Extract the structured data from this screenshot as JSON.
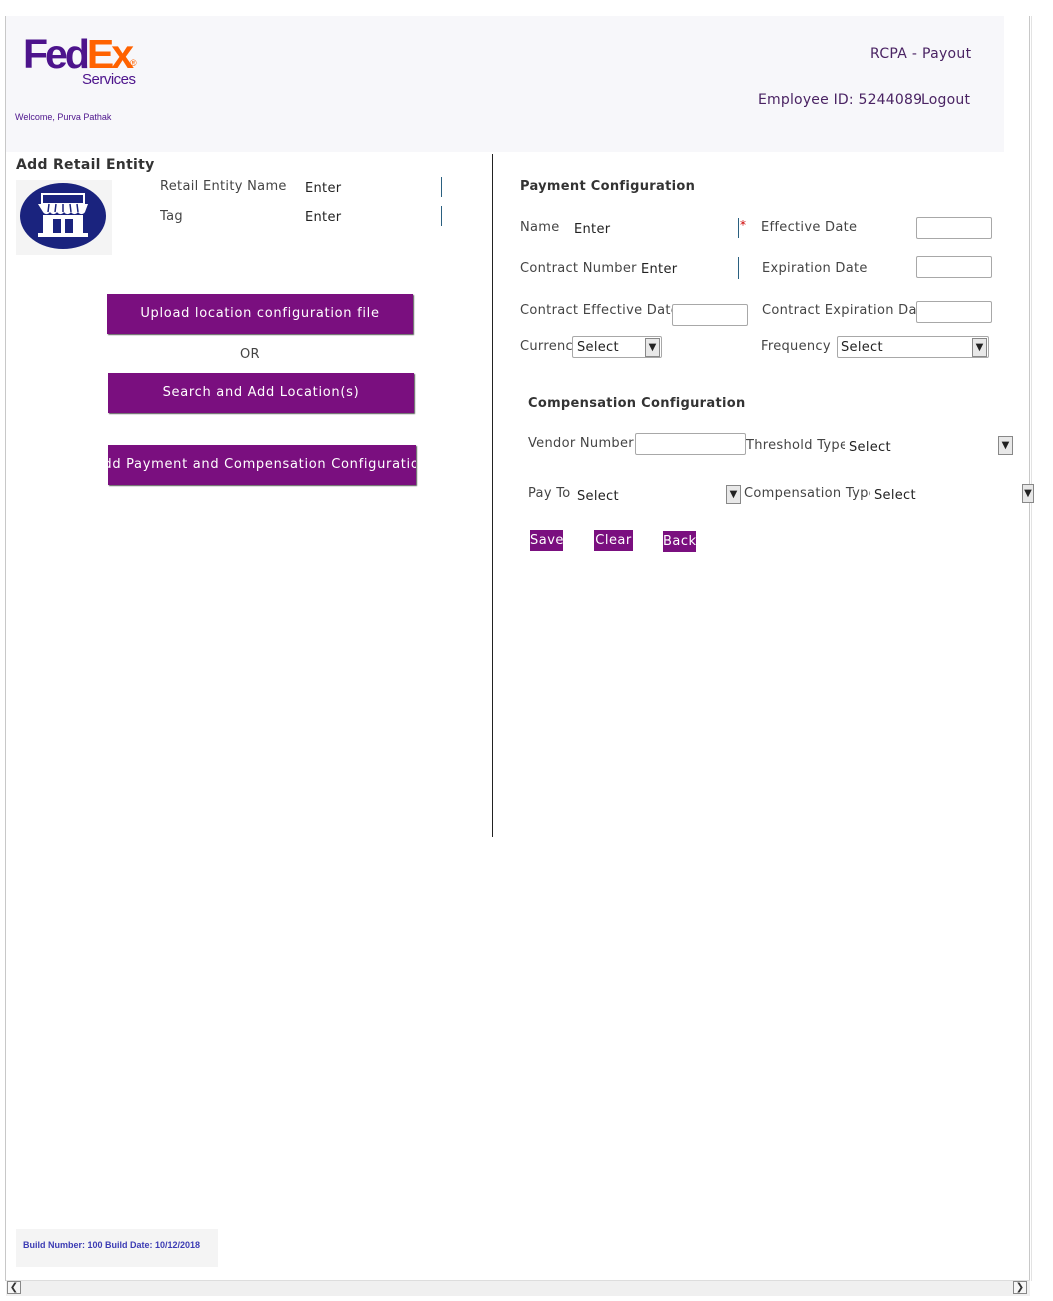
{
  "brand": {
    "logo_fed": "Fed",
    "logo_ex": "Ex",
    "logo_reg": "®",
    "logo_services": "Services",
    "primary_color": "#4d148c",
    "accent_color": "#ff6200",
    "button_color": "#7a0f7f"
  },
  "header": {
    "welcome": "Welcome, Purva Pathak",
    "app_title": "RCPA - Payout",
    "employee_id": "Employee ID: 5244089",
    "logout": "Logout"
  },
  "retail_entity": {
    "title": "Add Retail Entity",
    "icon": "store-icon",
    "name_label": "Retail Entity Name",
    "name_placeholder": "Enter",
    "tag_label": "Tag",
    "tag_placeholder": "Enter",
    "upload_button": "Upload location configuration file",
    "or_text": "OR",
    "search_button": "Search and Add Location(s)",
    "add_config_button": "Add Payment and Compensation Configuration"
  },
  "payment": {
    "title": "Payment Configuration",
    "name_label": "Name",
    "name_placeholder": "Enter",
    "required_mark": "*",
    "effective_date_label": "Effective Date",
    "contract_number_label": "Contract Number",
    "contract_number_placeholder": "Enter",
    "expiration_date_label": "Expiration Date",
    "contract_effective_label": "Contract Effective Date",
    "contract_expiration_label": "Contract Expiration Date",
    "currency_label": "Currency",
    "currency_value": "Select",
    "frequency_label": "Frequency",
    "frequency_value": "Select"
  },
  "compensation": {
    "title": "Compensation Configuration",
    "vendor_number_label": "Vendor Number",
    "threshold_type_label": "Threshold Type",
    "threshold_type_value": "Select",
    "pay_to_label": "Pay To",
    "pay_to_value": "Select",
    "compensation_type_label": "Compensation Type",
    "compensation_type_value": "Select"
  },
  "actions": {
    "save": "Save",
    "clear": "Clear",
    "back": "Back"
  },
  "footer": {
    "build_info": "Build Number: 100 Build Date: 10/12/2018"
  },
  "icons": {
    "dropdown": "chevron-down-icon",
    "scroll_left": "scroll-left-icon",
    "scroll_right": "scroll-right-icon"
  }
}
